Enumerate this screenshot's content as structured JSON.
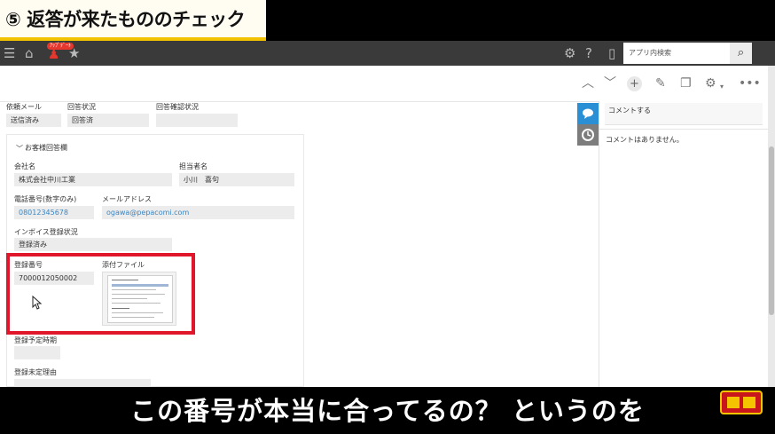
{
  "banner": {
    "title": "⑤ 返答が来たもののチェック"
  },
  "topbar": {
    "menu_icon": "hamburger-icon",
    "home_icon": "home-icon",
    "bell_badge": "ｱｯﾌﾟﾃﾞｰﾄ",
    "search_placeholder": "アプリ内検索"
  },
  "form": {
    "request_mail": {
      "label": "依頼メール",
      "value": "送信済み"
    },
    "reply_status": {
      "label": "回答状況",
      "value": "回答済"
    },
    "reply_confirm": {
      "label": "回答確認状況",
      "value": ""
    },
    "group_title": "お客様回答欄",
    "company": {
      "label": "会社名",
      "value": "株式会社中川工業"
    },
    "contact": {
      "label": "担当者名",
      "value": "小川　喜句"
    },
    "phone": {
      "label": "電話番号(数字のみ)",
      "value": "08012345678"
    },
    "email": {
      "label": "メールアドレス",
      "value": "ogawa@pepacomi.com"
    },
    "invoice_status": {
      "label": "インボイス登録状況",
      "value": "登録済み"
    },
    "reg_number": {
      "label": "登録番号",
      "value": "7000012050002"
    },
    "attachment": {
      "label": "添付ファイル"
    },
    "reg_planned": {
      "label": "登録予定時期",
      "value": ""
    },
    "unreg_reason": {
      "label": "登録未定理由",
      "value": ""
    }
  },
  "comments": {
    "input_placeholder": "コメントする",
    "empty_text": "コメントはありません。"
  },
  "subtitle": "この番号が本当に合ってるの？ というのを",
  "colors": {
    "highlight": "#e0162b",
    "accent": "#2b8fd6",
    "banner_bg": "#fffdf2"
  }
}
